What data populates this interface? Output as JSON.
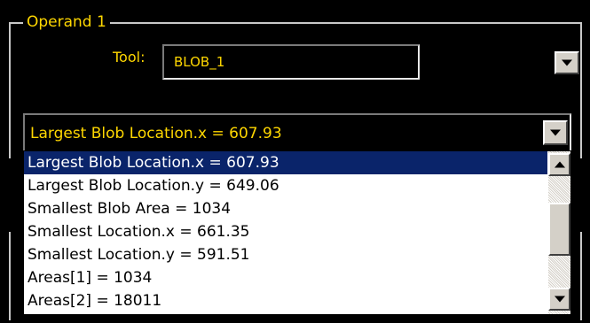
{
  "group": {
    "title": "Operand 1"
  },
  "tool": {
    "label": "Tool:",
    "value": "BLOB_1"
  },
  "measure": {
    "value": "Largest Blob Location.x = 607.93"
  },
  "dropdown": {
    "items": [
      {
        "label": "Largest Blob Location.x = 607.93",
        "selected": true
      },
      {
        "label": "Largest Blob Location.y = 649.06",
        "selected": false
      },
      {
        "label": "Smallest Blob Area = 1034",
        "selected": false
      },
      {
        "label": "Smallest Location.x = 661.35",
        "selected": false
      },
      {
        "label": "Smallest Location.y = 591.51",
        "selected": false
      },
      {
        "label": "Areas[1] = 1034",
        "selected": false
      },
      {
        "label": "Areas[2] = 18011",
        "selected": false
      }
    ]
  },
  "icons": {
    "tool_dropdown": "chevron-down-icon",
    "measure_dropdown": "chevron-down-icon",
    "scroll_up": "arrow-up-icon",
    "scroll_down": "arrow-down-icon"
  },
  "colors": {
    "background": "#000000",
    "label_text": "#ffd700",
    "selection": "#0a246a",
    "list_background": "#ffffff"
  }
}
